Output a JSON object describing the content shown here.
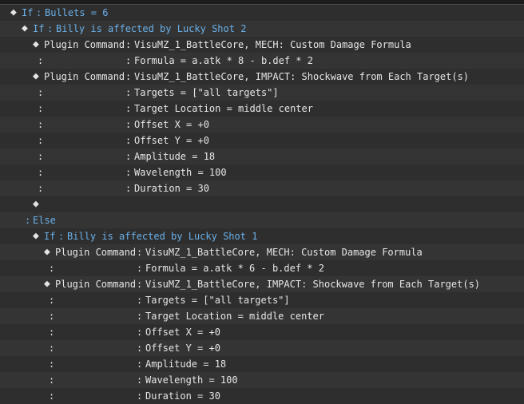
{
  "event_list": {
    "rows": [
      {
        "marker": "◆",
        "keyword": "If",
        "sep": ":",
        "text": "Bullets = 6"
      },
      {
        "marker": "◆",
        "keyword": "If",
        "sep": ":",
        "text": "Billy is affected by Lucky Shot 2"
      },
      {
        "marker": "◆",
        "keyword": "Plugin Command",
        "sep": ":",
        "text": "VisuMZ_1_BattleCore, MECH: Custom Damage Formula"
      },
      {
        "cont": ":",
        "sep": ":",
        "text": "Formula = a.atk * 8 - b.def * 2"
      },
      {
        "marker": "◆",
        "keyword": "Plugin Command",
        "sep": ":",
        "text": "VisuMZ_1_BattleCore, IMPACT: Shockwave from Each Target(s)"
      },
      {
        "cont": ":",
        "sep": ":",
        "text": "Targets = [\"all targets\"]"
      },
      {
        "cont": ":",
        "sep": ":",
        "text": "Target Location = middle center"
      },
      {
        "cont": ":",
        "sep": ":",
        "text": "Offset X = +0"
      },
      {
        "cont": ":",
        "sep": ":",
        "text": "Offset Y = +0"
      },
      {
        "cont": ":",
        "sep": ":",
        "text": "Amplitude = 18"
      },
      {
        "cont": ":",
        "sep": ":",
        "text": "Wavelength = 100"
      },
      {
        "cont": ":",
        "sep": ":",
        "text": "Duration = 30"
      },
      {
        "marker": "◆"
      },
      {
        "sep": ":",
        "keyword": "Else"
      },
      {
        "marker": "◆",
        "keyword": "If",
        "sep": ":",
        "text": "Billy is affected by Lucky Shot 1"
      },
      {
        "marker": "◆",
        "keyword": "Plugin Command",
        "sep": ":",
        "text": "VisuMZ_1_BattleCore, MECH: Custom Damage Formula"
      },
      {
        "cont": ":",
        "sep": ":",
        "text": "Formula = a.atk * 6 - b.def * 2"
      },
      {
        "marker": "◆",
        "keyword": "Plugin Command",
        "sep": ":",
        "text": "VisuMZ_1_BattleCore, IMPACT: Shockwave from Each Target(s)"
      },
      {
        "cont": ":",
        "sep": ":",
        "text": "Targets = [\"all targets\"]"
      },
      {
        "cont": ":",
        "sep": ":",
        "text": "Target Location = middle center"
      },
      {
        "cont": ":",
        "sep": ":",
        "text": "Offset X = +0"
      },
      {
        "cont": ":",
        "sep": ":",
        "text": "Offset Y = +0"
      },
      {
        "cont": ":",
        "sep": ":",
        "text": "Amplitude = 18"
      },
      {
        "cont": ":",
        "sep": ":",
        "text": "Wavelength = 100"
      },
      {
        "cont": ":",
        "sep": ":",
        "text": "Duration = 30"
      }
    ]
  },
  "colors": {
    "background": "#2b2b2b",
    "text": "#e6e6e6",
    "conditional": "#6ab0e8"
  }
}
